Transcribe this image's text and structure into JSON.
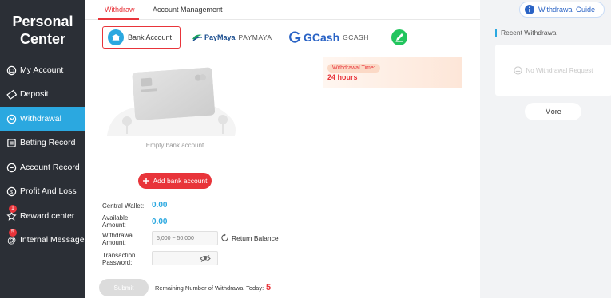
{
  "sidebar": {
    "title_line1": "Personal",
    "title_line2": "Center",
    "items": [
      {
        "label": "My Account"
      },
      {
        "label": "Deposit"
      },
      {
        "label": "Withdrawal"
      },
      {
        "label": "Betting Record"
      },
      {
        "label": "Account Record"
      },
      {
        "label": "Profit And Loss"
      },
      {
        "label": "Reward center",
        "badge": "1"
      },
      {
        "label": "Internal Message",
        "badge": "5"
      }
    ]
  },
  "tabs": [
    {
      "label": "Withdraw"
    },
    {
      "label": "Account Management"
    }
  ],
  "payment_options": {
    "bank": "Bank Account",
    "paymaya_brand": "PayMaya",
    "paymaya_text": "PAYMAYA",
    "gcash_brand": "GCash",
    "gcash_text": "GCASH"
  },
  "withdrawal_time": {
    "label": "Withdrawal Time:",
    "value": "24 hours"
  },
  "bank_empty": {
    "text": "Empty bank account",
    "add_button": "Add bank account"
  },
  "form": {
    "central_wallet_label": "Central Wallet:",
    "central_wallet_value": "0.00",
    "available_label_line1": "Available",
    "available_label_line2": "Amount:",
    "available_value": "0.00",
    "withdrawal_label_line1": "Withdrawal",
    "withdrawal_label_line2": "Amount:",
    "withdrawal_placeholder": "5,000 ~ 50,000",
    "return_balance": "Return Balance",
    "password_label_line1": "Transaction",
    "password_label_line2": "Password:"
  },
  "footer": {
    "submit": "Submit",
    "remaining_label": "Remaining Number of Withdrawal Today:",
    "remaining_value": "5"
  },
  "right_panel": {
    "guide": "Withdrawal Guide",
    "recent_title": "Recent Withdrawal",
    "no_request": "No Withdrawal Request",
    "more": "More"
  },
  "colors": {
    "accent_red": "#e8343a",
    "accent_blue": "#2ba8e0",
    "sidebar_bg": "#2b2f36",
    "gcash_blue": "#2a63c5",
    "green_button": "#22c55e"
  }
}
